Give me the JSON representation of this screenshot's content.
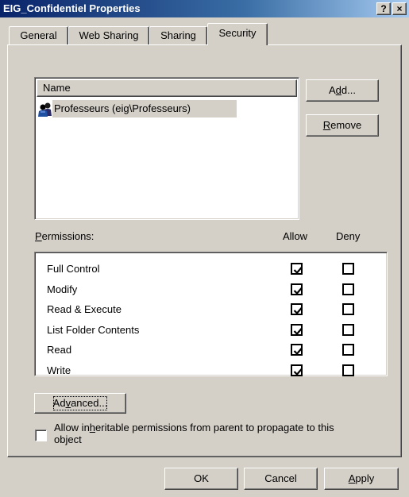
{
  "window": {
    "title": "EIG_Confidentiel Properties",
    "help_label": "?",
    "close_label": "×"
  },
  "tabs": [
    {
      "label": "General",
      "active": false
    },
    {
      "label": "Web Sharing",
      "active": false
    },
    {
      "label": "Sharing",
      "active": false
    },
    {
      "label": "Security",
      "active": true
    }
  ],
  "users": {
    "column_header": "Name",
    "items": [
      {
        "name": "Professeurs (eig\\Professeurs)",
        "icon": "user-group-icon",
        "selected": true
      }
    ]
  },
  "buttons": {
    "add": {
      "pre": "A",
      "key": "d",
      "post": "d..."
    },
    "remove": {
      "pre": "",
      "key": "R",
      "post": "emove"
    },
    "advanced": {
      "pre": "Ad",
      "key": "v",
      "post": "anced..."
    },
    "ok": "OK",
    "cancel": "Cancel",
    "apply": {
      "pre": "",
      "key": "A",
      "post": "pply"
    }
  },
  "permissions": {
    "label_key": "P",
    "label_rest": "ermissions:",
    "allow_header": "Allow",
    "deny_header": "Deny",
    "rows": [
      {
        "name": "Full Control",
        "allow": true,
        "deny": false
      },
      {
        "name": "Modify",
        "allow": true,
        "deny": false
      },
      {
        "name": "Read & Execute",
        "allow": true,
        "deny": false
      },
      {
        "name": "List Folder Contents",
        "allow": true,
        "deny": false
      },
      {
        "name": "Read",
        "allow": true,
        "deny": false
      },
      {
        "name": "Write",
        "allow": true,
        "deny": false
      }
    ]
  },
  "inherit": {
    "line1_pre": "Allow in",
    "line1_key": "h",
    "line1_post": "eritable permissions from parent to propagate to this",
    "line2": "object",
    "checked": false
  }
}
